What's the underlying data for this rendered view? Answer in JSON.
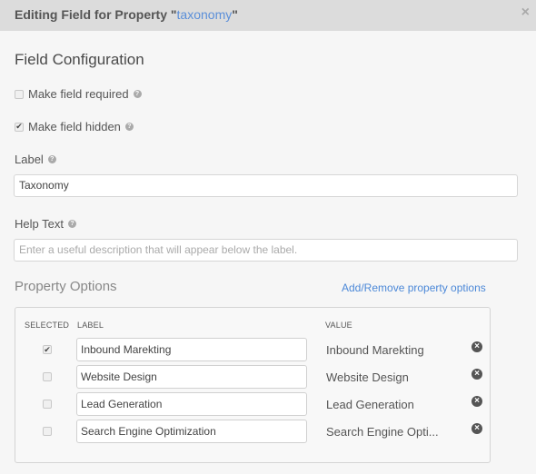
{
  "header": {
    "title_prefix": "Editing Field for Property \"",
    "property_name": "taxonomy",
    "title_suffix": "\"",
    "close_icon": "×"
  },
  "config": {
    "section_title": "Field Configuration",
    "required": {
      "label": "Make field required",
      "checked": false
    },
    "hidden": {
      "label": "Make field hidden",
      "checked": true
    },
    "help_icon": "?"
  },
  "label_field": {
    "label": "Label",
    "value": "Taxonomy"
  },
  "help_text_field": {
    "label": "Help Text",
    "value": "",
    "placeholder": "Enter a useful description that will appear below the label."
  },
  "property_options": {
    "title": "Property Options",
    "add_remove_link": "Add/Remove property options",
    "columns": {
      "selected": "SELECTED",
      "label": "LABEL",
      "value": "VALUE"
    },
    "remove_icon": "×",
    "check_mark": "✔",
    "rows": [
      {
        "selected": true,
        "label": "Inbound Marekting",
        "value": "Inbound Marekting"
      },
      {
        "selected": false,
        "label": "Website Design",
        "value": "Website Design"
      },
      {
        "selected": false,
        "label": "Lead Generation",
        "value": "Lead Generation"
      },
      {
        "selected": false,
        "label": "Search Engine Optimization",
        "value": "Search Engine Opti..."
      }
    ]
  }
}
